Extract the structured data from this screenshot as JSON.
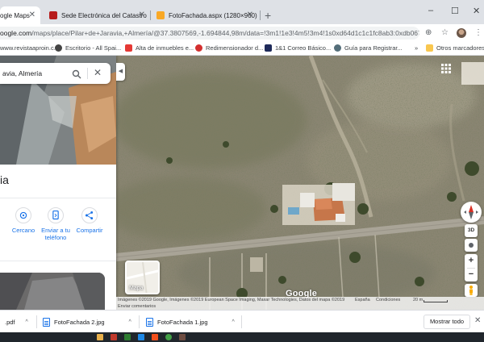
{
  "browser": {
    "tabs": [
      {
        "title": "ogle Maps",
        "active": true
      },
      {
        "title": "Sede Electrónica del Catastro",
        "active": false
      },
      {
        "title": "FotoFachada.aspx (1280×960)",
        "active": false
      }
    ],
    "new_tab_label": "+",
    "window_controls": {
      "minimize": "–",
      "maximize": "☐",
      "close": "✕"
    },
    "url_host": "oogle.com",
    "url_rest": "/maps/place/Pilar+de+Jaravia,+Almería/@37.3807569,-1.694844,98m/data=!3m1!1e3!4m5!3m4!1s0xd64d1c1c1fc8ab3:0xdb067d1f840541..."
  },
  "bookmarks": {
    "items": [
      {
        "label": "www.revistaaproin.c...",
        "color": "#1565c0"
      },
      {
        "label": "Escritorio - All Spai...",
        "color": "#444444"
      },
      {
        "label": "Alta de inmuebles e...",
        "color": "#e53935"
      },
      {
        "label": "Redimensionador d...",
        "color": "#d32f2f"
      },
      {
        "label": "1&1 Correo Básico...",
        "color": "#1e2a5a"
      },
      {
        "label": "Guía para Registrar...",
        "color": "#546e7a"
      }
    ],
    "more": "»",
    "other_folder": "Otros marcadores"
  },
  "maps": {
    "search_value": "avia, Almería",
    "place_title": "ia",
    "actions": [
      {
        "label": "Cercano",
        "icon": "nearby-icon"
      },
      {
        "label": "Enviar a tu teléfono",
        "icon": "phone-icon"
      },
      {
        "label": "Compartir",
        "icon": "share-icon"
      }
    ],
    "collapse_arrow": "◀",
    "layer_label": "Mapa",
    "google_logo": "Google",
    "btn_3d": "3D",
    "zoom_in": "+",
    "zoom_out": "−",
    "attribution": "Imágenes ©2019 Google, Imágenes ©2019 European Space Imaging, Maxar Technologies, Datos del mapa ©2019",
    "send_feedback": "Enviar comentarios",
    "footer_espana": "España",
    "footer_conditions": "Condiciones",
    "scale_label": "20 m"
  },
  "downloads": {
    "items": [
      {
        "name": ".pdf"
      },
      {
        "name": "FotoFachada 2.jpg"
      },
      {
        "name": "FotoFachada 1.jpg"
      }
    ],
    "show_all": "Mostrar todo",
    "close": "✕"
  },
  "colors": {
    "accent": "#1a73e8",
    "chrome_bg": "#dee1e6",
    "taskbar": "#20262c"
  }
}
